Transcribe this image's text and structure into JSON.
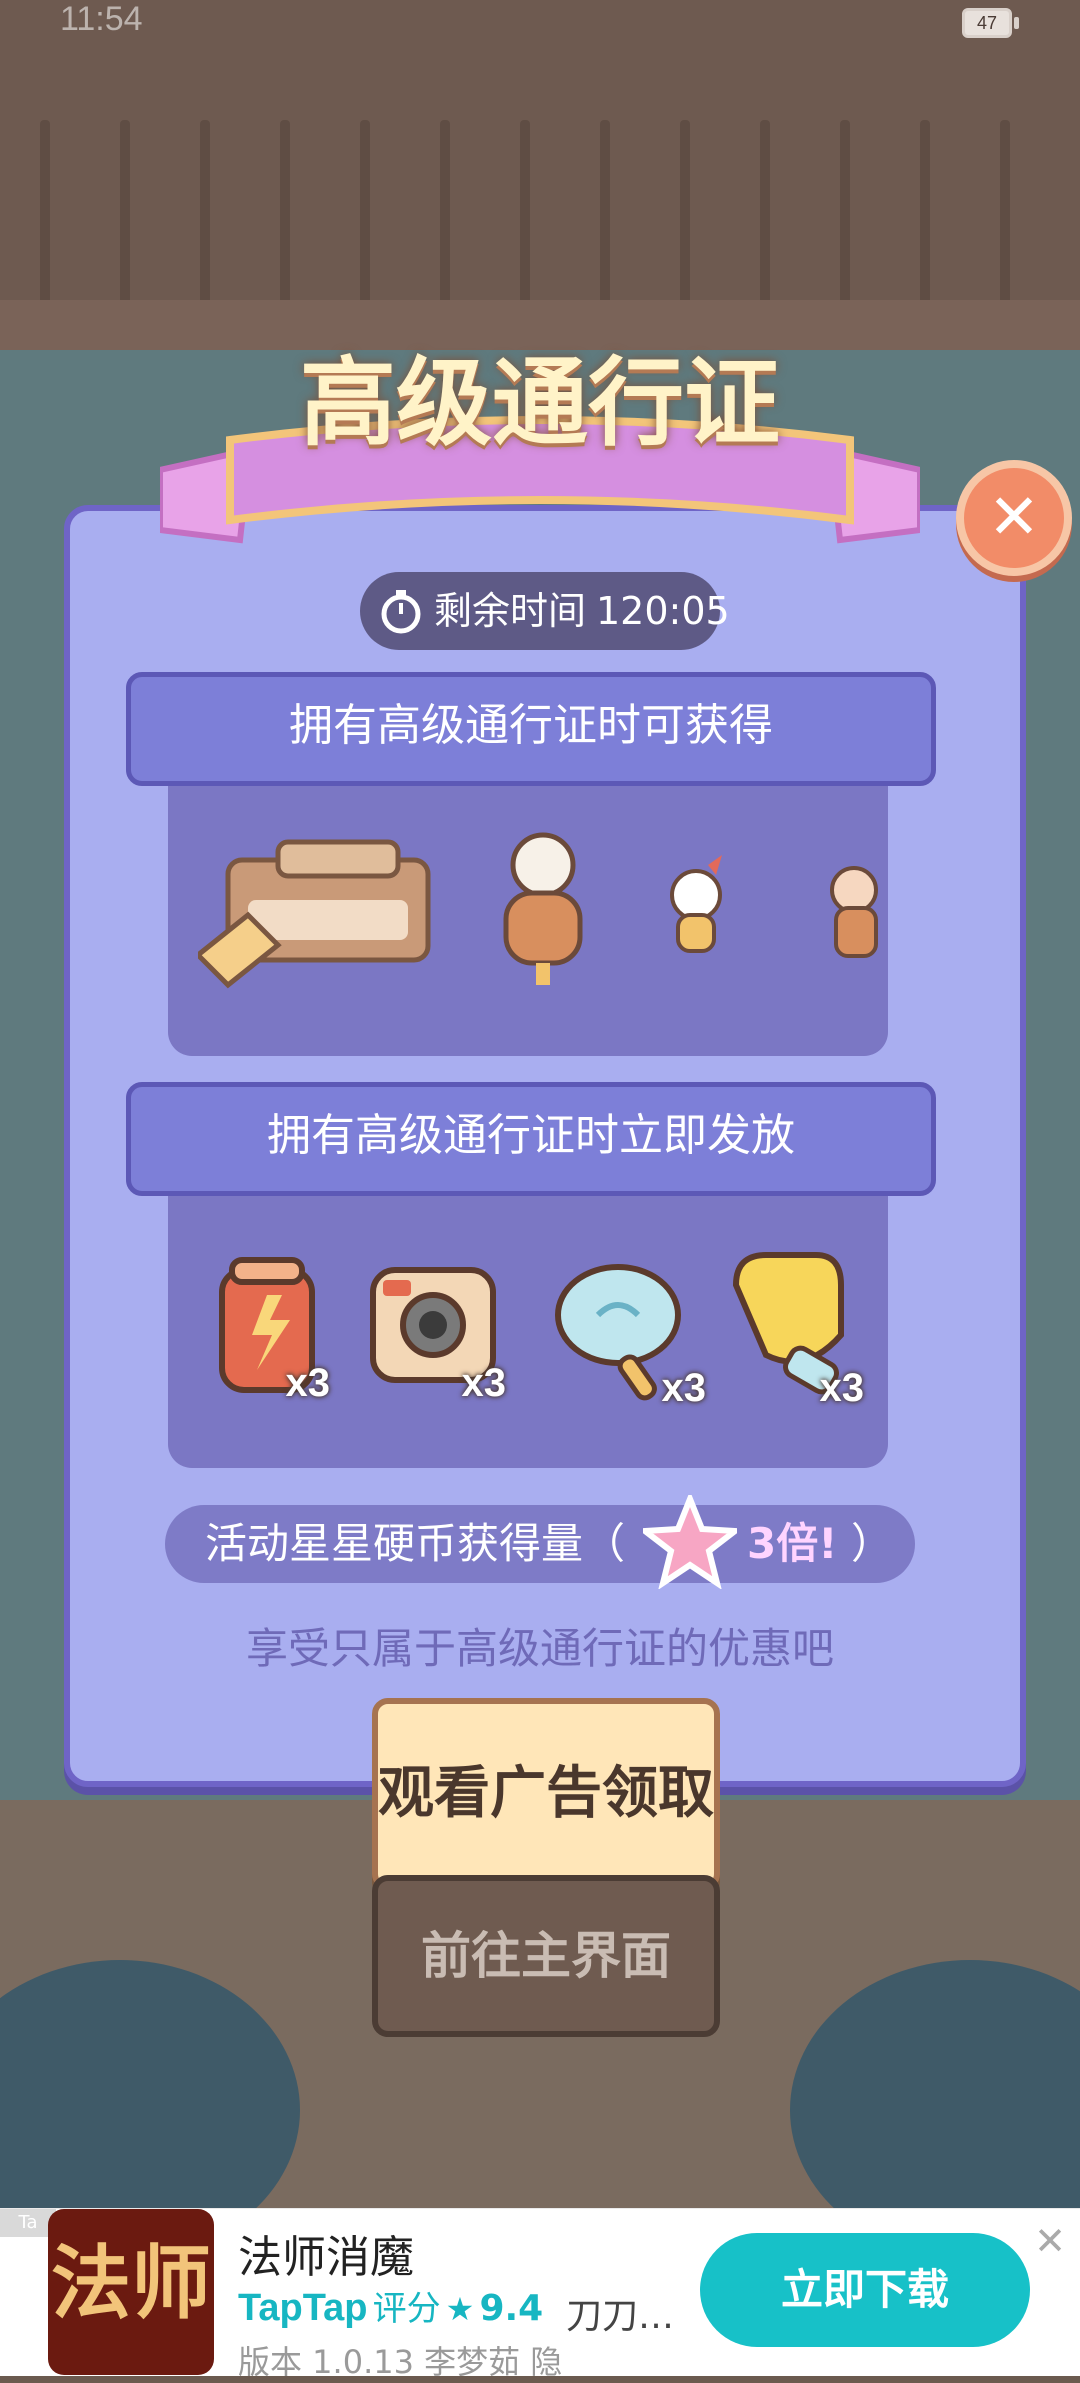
{
  "status": {
    "time": "11:54",
    "battery": "47"
  },
  "dialog": {
    "title": "高级通行证",
    "timer": {
      "label": "剩余时间",
      "value": "120:05"
    },
    "section1": {
      "title": "拥有高级通行证时可获得"
    },
    "section2": {
      "title": "拥有高级通行证时立即发放",
      "items": [
        {
          "icon": "battery-can-icon",
          "count": "x3"
        },
        {
          "icon": "camera-icon",
          "count": "x3"
        },
        {
          "icon": "fan-icon",
          "count": "x3"
        },
        {
          "icon": "glove-icon",
          "count": "x3"
        }
      ]
    },
    "coin_bonus": {
      "text": "活动星星硬币获得量（",
      "multiplier": "3倍!",
      "close_paren": "）"
    },
    "hint": "享受只属于高级通行证的优惠吧",
    "primary_button": "观看广告领取",
    "secondary_button": "前往主界面"
  },
  "ad": {
    "tag": "Ta",
    "app_icon_text": "法师",
    "title": "法师消魔",
    "brand": "TapTap",
    "score_label": "评分",
    "score": "9.4",
    "tagline": "刀刀…",
    "meta": "版本 1.0.13   李梦茹   隐",
    "cta": "立即下载"
  },
  "colors": {
    "modal_bg": "#a9aef0",
    "accent": "#17c1c8",
    "title": "#fff3c8"
  }
}
